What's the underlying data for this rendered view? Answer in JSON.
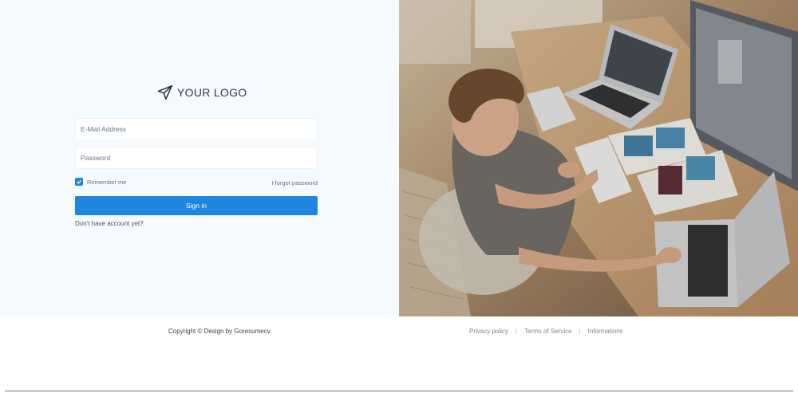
{
  "logo": {
    "text": "YOUR LOGO",
    "icon": "paper-plane-icon"
  },
  "form": {
    "email_placeholder": "E-Mail Address",
    "password_placeholder": "Password",
    "remember_label": "Remember me",
    "remember_checked": true,
    "forgot_label": "I forgot password",
    "signin_label": "Sign in",
    "no_account_label": "Don't have account yet?"
  },
  "footer": {
    "copyright": "Copyright © Design by Goresumecv",
    "links": [
      "Privacy policy",
      "Terms of Service",
      "Informations"
    ]
  },
  "colors": {
    "accent": "#1f86e0",
    "panel_bg": "#f5faff"
  }
}
